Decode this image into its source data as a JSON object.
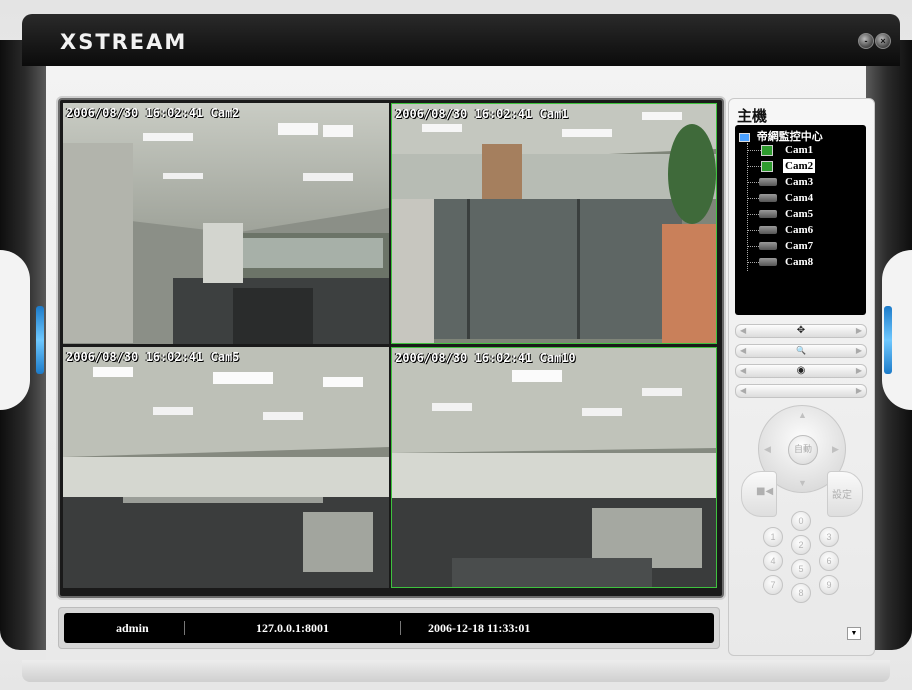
{
  "window": {
    "title": "XSTREAM",
    "minimize_glyph": "-",
    "close_glyph": "×"
  },
  "cameras_view": [
    {
      "osd": "2006/08/30 16:02:41 Cam2"
    },
    {
      "osd": "2006/08/30 16:02:41 Cam1"
    },
    {
      "osd": "2006/08/30 16:02:41 Cam5"
    },
    {
      "osd": "2006/08/30 16:02:41 Cam10"
    }
  ],
  "status": {
    "user": "admin",
    "address": "127.0.0.1:8001",
    "datetime": "2006-12-18  11:33:01"
  },
  "panel": {
    "host_title": "主機",
    "tree_root": "帝網監控中心",
    "cameras": [
      {
        "label": "Cam1",
        "active": true,
        "selected": false
      },
      {
        "label": "Cam2",
        "active": true,
        "selected": true
      },
      {
        "label": "Cam3",
        "active": false,
        "selected": false
      },
      {
        "label": "Cam4",
        "active": false,
        "selected": false
      },
      {
        "label": "Cam5",
        "active": false,
        "selected": false
      },
      {
        "label": "Cam6",
        "active": false,
        "selected": false
      },
      {
        "label": "Cam7",
        "active": false,
        "selected": false
      },
      {
        "label": "Cam8",
        "active": false,
        "selected": false
      }
    ],
    "control_bars": [
      {
        "icon": "move-icon",
        "glyph": "✥"
      },
      {
        "icon": "zoom-icon",
        "glyph": "🔍"
      },
      {
        "icon": "focus-icon",
        "glyph": "◉"
      },
      {
        "icon": "blank-icon",
        "glyph": ""
      }
    ],
    "auto_label": "自動",
    "settings_label": "設定",
    "keypad": [
      "0",
      "1",
      "2",
      "3",
      "4",
      "5",
      "6",
      "7",
      "8",
      "9"
    ]
  },
  "colors": {
    "active_border": "#3ec23e",
    "accent_glow": "#6ec8ff"
  }
}
